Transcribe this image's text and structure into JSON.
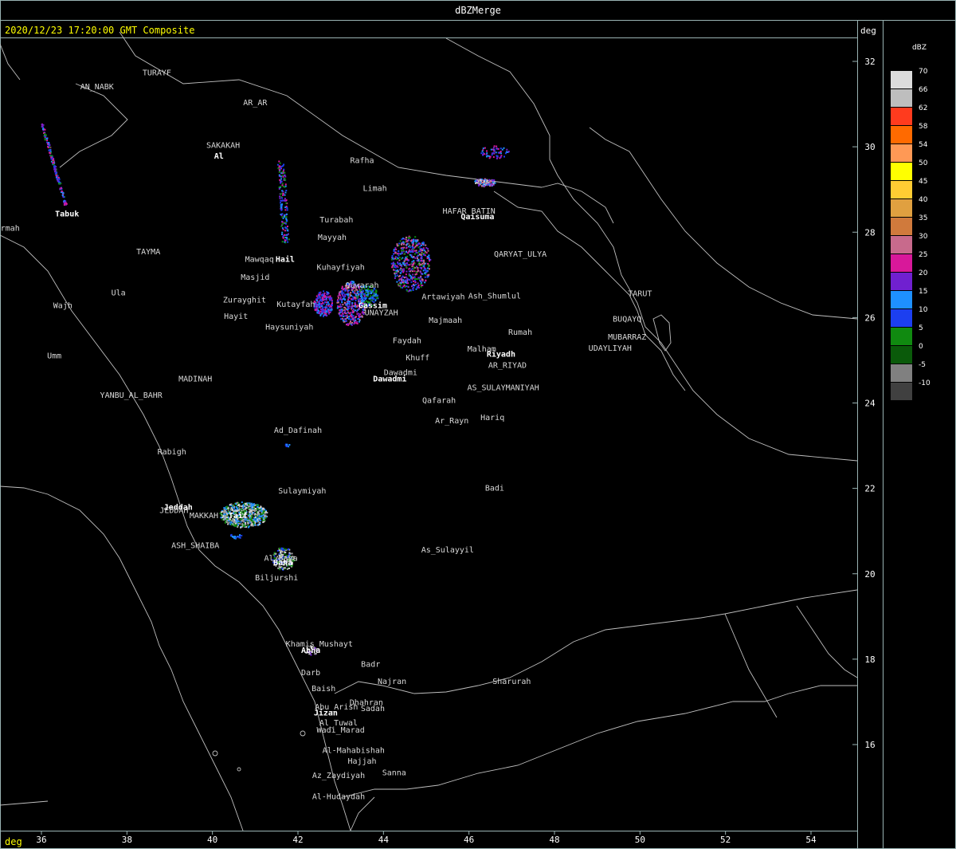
{
  "header": {
    "window_title": "dBZMerge",
    "timestamp": "2020/12/23 17:20:00 GMT Composite",
    "right_unit": "deg",
    "bottom_unit": "deg"
  },
  "colors": {
    "border": "#9ab3b3",
    "title_text": "#ffffff",
    "timestamp_text": "#ffff00",
    "map_lines": "#bfbfbf"
  },
  "lat_labels": [
    {
      "text": "32",
      "value": 32
    },
    {
      "text": "30",
      "value": 30
    },
    {
      "text": "28",
      "value": 28
    },
    {
      "text": "26",
      "value": 26
    },
    {
      "text": "24",
      "value": 24
    },
    {
      "text": "22",
      "value": 22
    },
    {
      "text": "20",
      "value": 20
    },
    {
      "text": "18",
      "value": 18
    },
    {
      "text": "16",
      "value": 16
    }
  ],
  "lon_labels": [
    {
      "text": "36",
      "value": 36
    },
    {
      "text": "38",
      "value": 38
    },
    {
      "text": "40",
      "value": 40
    },
    {
      "text": "42",
      "value": 42
    },
    {
      "text": "44",
      "value": 44
    },
    {
      "text": "46",
      "value": 46
    },
    {
      "text": "48",
      "value": 48
    },
    {
      "text": "50",
      "value": 50
    },
    {
      "text": "52",
      "value": 52
    },
    {
      "text": "54",
      "value": 54
    }
  ],
  "legend": {
    "title": "dBZ",
    "items": [
      {
        "label": "70",
        "color": "#dcdcdc"
      },
      {
        "label": "66",
        "color": "#bebebe"
      },
      {
        "label": "62",
        "color": "#ff3b1e"
      },
      {
        "label": "58",
        "color": "#ff6a00"
      },
      {
        "label": "54",
        "color": "#ff9955"
      },
      {
        "label": "50",
        "color": "#ffff00"
      },
      {
        "label": "45",
        "color": "#ffcc33"
      },
      {
        "label": "40",
        "color": "#e0a040"
      },
      {
        "label": "35",
        "color": "#d07a3c"
      },
      {
        "label": "30",
        "color": "#c86a8c"
      },
      {
        "label": "25",
        "color": "#d8189a"
      },
      {
        "label": "20",
        "color": "#7020d0"
      },
      {
        "label": "15",
        "color": "#1e90ff"
      },
      {
        "label": "10",
        "color": "#1c3ff0"
      },
      {
        "label": "5",
        "color": "#108a10"
      },
      {
        "label": "0",
        "color": "#0a5a0a"
      },
      {
        "label": "-5",
        "color": "#808080"
      },
      {
        "label": "-10",
        "color": "#404040"
      }
    ]
  },
  "places": [
    {
      "name": "AN_NABK",
      "lon": 37.3,
      "lat": 31.35,
      "bold": false
    },
    {
      "name": "TURAYF",
      "lon": 38.7,
      "lat": 31.67,
      "bold": false
    },
    {
      "name": "AR_AR",
      "lon": 41.0,
      "lat": 30.97,
      "bold": false
    },
    {
      "name": "SAKAKAH",
      "lon": 40.25,
      "lat": 29.97,
      "bold": false
    },
    {
      "name": "Al",
      "lon": 40.15,
      "lat": 29.72,
      "bold": true
    },
    {
      "name": "Rafha",
      "lon": 43.5,
      "lat": 29.62,
      "bold": false
    },
    {
      "name": "Limah",
      "lon": 43.8,
      "lat": 28.97,
      "bold": false
    },
    {
      "name": "HAFAR_BATIN",
      "lon": 46.0,
      "lat": 28.43,
      "bold": false
    },
    {
      "name": "Qaisuma",
      "lon": 46.2,
      "lat": 28.3,
      "bold": true
    },
    {
      "name": "Tabuk",
      "lon": 36.6,
      "lat": 28.37,
      "bold": true
    },
    {
      "name": "Turabah",
      "lon": 42.9,
      "lat": 28.23,
      "bold": false
    },
    {
      "name": "Sharmah",
      "lon": 35.1,
      "lat": 28.03,
      "bold": false
    },
    {
      "name": "Mayyah",
      "lon": 42.8,
      "lat": 27.82,
      "bold": false
    },
    {
      "name": "TAYMA",
      "lon": 38.5,
      "lat": 27.48,
      "bold": false
    },
    {
      "name": "QARYAT_ULYA",
      "lon": 47.2,
      "lat": 27.43,
      "bold": false
    },
    {
      "name": "Hail",
      "lon": 41.7,
      "lat": 27.3,
      "bold": true
    },
    {
      "name": "Mawqaq",
      "lon": 41.1,
      "lat": 27.3,
      "bold": false
    },
    {
      "name": "Kuhayfiyah",
      "lon": 43.0,
      "lat": 27.12,
      "bold": false
    },
    {
      "name": "Masjid",
      "lon": 41.0,
      "lat": 26.88,
      "bold": false
    },
    {
      "name": "Quwarah",
      "lon": 43.5,
      "lat": 26.7,
      "bold": false
    },
    {
      "name": "Ula",
      "lon": 37.8,
      "lat": 26.52,
      "bold": false
    },
    {
      "name": "Artawiyah",
      "lon": 45.4,
      "lat": 26.43,
      "bold": false
    },
    {
      "name": "Ash_Shumlul",
      "lon": 46.6,
      "lat": 26.45,
      "bold": false
    },
    {
      "name": "TARUT",
      "lon": 50.0,
      "lat": 26.5,
      "bold": false
    },
    {
      "name": "Zurayghit",
      "lon": 40.75,
      "lat": 26.35,
      "bold": false
    },
    {
      "name": "Kutayfah",
      "lon": 41.95,
      "lat": 26.25,
      "bold": false
    },
    {
      "name": "Gassim",
      "lon": 43.75,
      "lat": 26.22,
      "bold": true
    },
    {
      "name": "Wajh",
      "lon": 36.5,
      "lat": 26.22,
      "bold": false
    },
    {
      "name": "UNAYZAH",
      "lon": 43.95,
      "lat": 26.05,
      "bold": false
    },
    {
      "name": "Hayit",
      "lon": 40.55,
      "lat": 25.97,
      "bold": false
    },
    {
      "name": "Majmaah",
      "lon": 45.45,
      "lat": 25.88,
      "bold": false
    },
    {
      "name": "BUQAYQ",
      "lon": 49.7,
      "lat": 25.9,
      "bold": false
    },
    {
      "name": "Haysuniyah",
      "lon": 41.8,
      "lat": 25.72,
      "bold": false
    },
    {
      "name": "Rumah",
      "lon": 47.2,
      "lat": 25.6,
      "bold": false
    },
    {
      "name": "MUBARRAZ",
      "lon": 49.7,
      "lat": 25.48,
      "bold": false
    },
    {
      "name": "Faydah",
      "lon": 44.55,
      "lat": 25.4,
      "bold": false
    },
    {
      "name": "Malham",
      "lon": 46.3,
      "lat": 25.2,
      "bold": false
    },
    {
      "name": "UDAYLIYAH",
      "lon": 49.3,
      "lat": 25.22,
      "bold": false
    },
    {
      "name": "Riyadh",
      "lon": 46.75,
      "lat": 25.08,
      "bold": true
    },
    {
      "name": "Umm",
      "lon": 36.3,
      "lat": 25.05,
      "bold": false
    },
    {
      "name": "Khuff",
      "lon": 44.8,
      "lat": 25.0,
      "bold": false
    },
    {
      "name": "AR_RIYAD",
      "lon": 46.9,
      "lat": 24.82,
      "bold": false
    },
    {
      "name": "Dawadmi",
      "lon": 44.4,
      "lat": 24.65,
      "bold": false
    },
    {
      "name": "Dawadmi",
      "lon": 44.15,
      "lat": 24.5,
      "bold": true
    },
    {
      "name": "MADINAH",
      "lon": 39.6,
      "lat": 24.5,
      "bold": false
    },
    {
      "name": "AS_SULAYMANIYAH",
      "lon": 46.8,
      "lat": 24.3,
      "bold": false
    },
    {
      "name": "YANBU_AL_BAHR",
      "lon": 38.1,
      "lat": 24.12,
      "bold": false
    },
    {
      "name": "Qafarah",
      "lon": 45.3,
      "lat": 24.0,
      "bold": false
    },
    {
      "name": "Hariq",
      "lon": 46.55,
      "lat": 23.6,
      "bold": false
    },
    {
      "name": "Ar_Rayn",
      "lon": 45.6,
      "lat": 23.52,
      "bold": false
    },
    {
      "name": "Ad_Dafinah",
      "lon": 42.0,
      "lat": 23.3,
      "bold": false
    },
    {
      "name": "Rabigh",
      "lon": 39.05,
      "lat": 22.8,
      "bold": false
    },
    {
      "name": "Badi",
      "lon": 46.6,
      "lat": 21.95,
      "bold": false
    },
    {
      "name": "Sulaymiyah",
      "lon": 42.1,
      "lat": 21.88,
      "bold": false
    },
    {
      "name": "Jeddah",
      "lon": 39.2,
      "lat": 21.5,
      "bold": true
    },
    {
      "name": "JEDDAH",
      "lon": 39.1,
      "lat": 21.42,
      "bold": false
    },
    {
      "name": "MAKKAH",
      "lon": 39.8,
      "lat": 21.3,
      "bold": false
    },
    {
      "name": "Taif",
      "lon": 40.6,
      "lat": 21.3,
      "bold": true
    },
    {
      "name": "ASH_SHAIBA",
      "lon": 39.6,
      "lat": 20.6,
      "bold": false
    },
    {
      "name": "As_Sulayyil",
      "lon": 45.5,
      "lat": 20.5,
      "bold": false
    },
    {
      "name": "Al_Baha",
      "lon": 41.6,
      "lat": 20.3,
      "bold": false
    },
    {
      "name": "Baha",
      "lon": 41.65,
      "lat": 20.2,
      "bold": true
    },
    {
      "name": "Biljurshi",
      "lon": 41.5,
      "lat": 19.85,
      "bold": false
    },
    {
      "name": "Khamis_Mushayt",
      "lon": 42.5,
      "lat": 18.3,
      "bold": false
    },
    {
      "name": "Abha",
      "lon": 42.3,
      "lat": 18.15,
      "bold": true
    },
    {
      "name": "Badr",
      "lon": 43.7,
      "lat": 17.82,
      "bold": false
    },
    {
      "name": "Darb",
      "lon": 42.3,
      "lat": 17.62,
      "bold": false
    },
    {
      "name": "Najran",
      "lon": 44.2,
      "lat": 17.42,
      "bold": false
    },
    {
      "name": "Sharurah",
      "lon": 47.0,
      "lat": 17.42,
      "bold": false
    },
    {
      "name": "Baish",
      "lon": 42.6,
      "lat": 17.25,
      "bold": false
    },
    {
      "name": "Dhahran",
      "lon": 43.6,
      "lat": 16.92,
      "bold": false
    },
    {
      "name": "Abu_Arish",
      "lon": 42.9,
      "lat": 16.82,
      "bold": false
    },
    {
      "name": "Sadah",
      "lon": 43.75,
      "lat": 16.78,
      "bold": false
    },
    {
      "name": "Jizan",
      "lon": 42.65,
      "lat": 16.68,
      "bold": true
    },
    {
      "name": "Al_Tuwal",
      "lon": 42.95,
      "lat": 16.45,
      "bold": false
    },
    {
      "name": "Wadi_Marad",
      "lon": 43.0,
      "lat": 16.28,
      "bold": false
    },
    {
      "name": "Al-Mahabishah",
      "lon": 43.3,
      "lat": 15.8,
      "bold": false
    },
    {
      "name": "Hajjah",
      "lon": 43.5,
      "lat": 15.55,
      "bold": false
    },
    {
      "name": "Az_Zaydiyah",
      "lon": 42.95,
      "lat": 15.22,
      "bold": false
    },
    {
      "name": "Sanna",
      "lon": 44.25,
      "lat": 15.28,
      "bold": false
    },
    {
      "name": "Al-Hudaydah",
      "lon": 42.95,
      "lat": 14.72,
      "bold": false
    }
  ]
}
